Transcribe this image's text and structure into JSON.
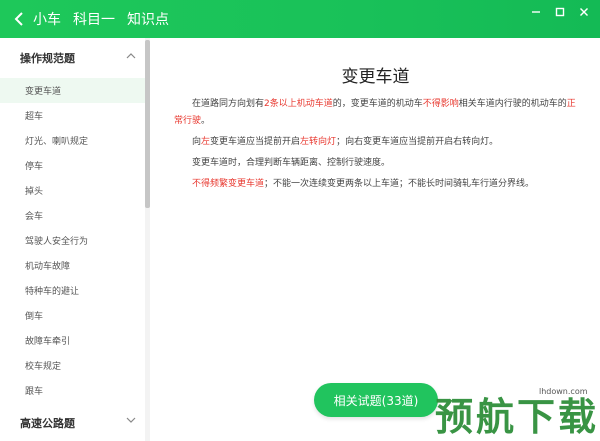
{
  "header": {
    "crumbs": [
      "小车",
      "科目一",
      "知识点"
    ],
    "accent": "#1ec85a"
  },
  "sidebar": {
    "group1": "操作规范题",
    "group2": "高速公路题",
    "items": [
      "变更车道",
      "超车",
      "灯光、喇叭规定",
      "停车",
      "掉头",
      "会车",
      "驾驶人安全行为",
      "机动车故障",
      "特种车的避让",
      "倒车",
      "故障车牵引",
      "校车规定",
      "跟车"
    ],
    "active_index": 0
  },
  "content": {
    "title": "变更车道",
    "p1": {
      "a": "在道路同方向划有",
      "b": "2条以上机动车道",
      "c": "的，变更车道的机动车",
      "d": "不得影响",
      "e": "相关车道内行驶的机动车的",
      "f": "正常行驶",
      "g": "。"
    },
    "p2": {
      "a": "向",
      "b": "左",
      "c": "变更车道应当提前开启",
      "d": "左转向灯",
      "e": "；向右变更车道应当提前开启右转向灯。"
    },
    "p3": "变更车道时，合理判断车辆距离、控制行驶速度。",
    "p4": {
      "a": "不得频繁变更车道",
      "b": "；不能一次连续变更两条以上车道；不能长时间骑轧车行道分界线。"
    },
    "highlight": "#e8382f"
  },
  "related_button": "相关试题(33道)",
  "watermark": {
    "text": "预航下载",
    "url": "lhdown.com"
  },
  "icons": {
    "back": "chevron-left-icon",
    "min": "minimize-icon",
    "max": "maximize-icon",
    "close": "close-icon"
  }
}
